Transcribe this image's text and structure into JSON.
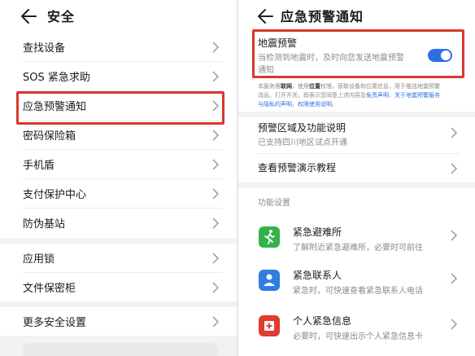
{
  "left": {
    "title": "安全",
    "items": [
      {
        "label": "查找设备"
      },
      {
        "label": "SOS 紧急求助"
      },
      {
        "label": "应急预警通知"
      },
      {
        "label": "密码保险箱"
      },
      {
        "label": "手机盾"
      },
      {
        "label": "支付保护中心"
      },
      {
        "label": "防伪基站"
      },
      {
        "label": "应用锁"
      },
      {
        "label": "文件保密柜"
      },
      {
        "label": "更多安全设置"
      }
    ]
  },
  "right": {
    "title": "应急预警通知",
    "quake": {
      "title": "地震预警",
      "desc_line1": "当检测到地震时，及时向您发送地震预警",
      "desc_line2": "通知",
      "toggle_on": true
    },
    "notice": {
      "line1_a": "本服务需",
      "line1_b": "联网",
      "line1_c": "，使用",
      "line1_d": "位置",
      "line1_e": "权限，获取设备和位置信息，用于推送地震预警",
      "line2_a": "消息。打开开关，即表示您同意上述内容及",
      "line2_b": "免责声明",
      "line2_c": "、",
      "line2_d": "关于地震预警服务",
      "line3_a": "与隐私的声明",
      "line3_b": "，",
      "line3_c": "权限使用说明",
      "line3_d": "。"
    },
    "region": {
      "title": "预警区域及功能说明",
      "desc": "已支持四川地区试点开通"
    },
    "demo": {
      "title": "查看预警演示教程"
    },
    "section_label": "功能设置",
    "features": [
      {
        "title": "紧急避难所",
        "desc": "了解附近紧急避难所，必要时可前往",
        "icon": "running-person-icon",
        "color": "#34b24a"
      },
      {
        "title": "紧急联系人",
        "desc": "紧急时，可快速查看紧急联系人电话",
        "icon": "contact-person-icon",
        "color": "#2f7de1"
      },
      {
        "title": "个人紧急信息",
        "desc": "必要时，可快速出示个人紧急信息卡",
        "icon": "medical-cross-icon",
        "color": "#e03c31"
      }
    ]
  },
  "colors": {
    "highlight": "#d8392b",
    "accent": "#2f6fe6"
  }
}
